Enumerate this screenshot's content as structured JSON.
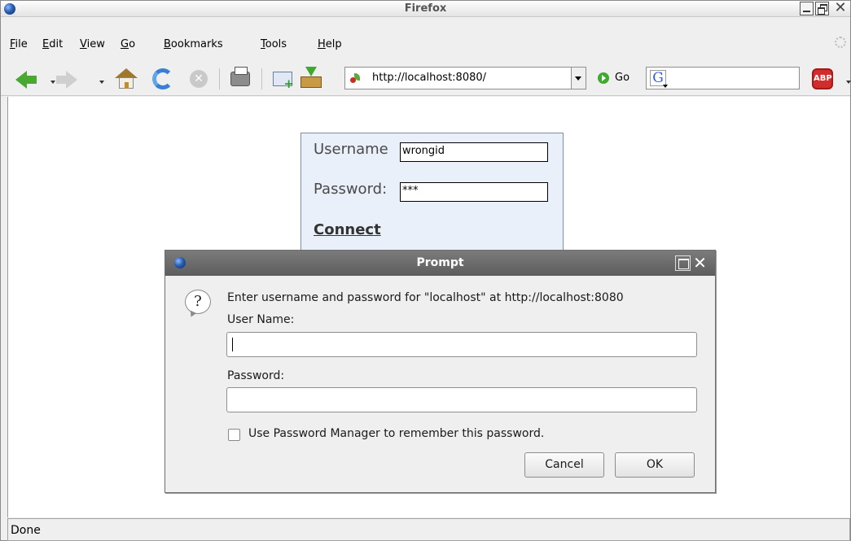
{
  "window": {
    "title": "Firefox"
  },
  "menubar": {
    "items": [
      {
        "label": "File"
      },
      {
        "label": "Edit"
      },
      {
        "label": "View"
      },
      {
        "label": "Go"
      },
      {
        "label": "Bookmarks"
      },
      {
        "label": "Tools"
      },
      {
        "label": "Help"
      }
    ]
  },
  "toolbar": {
    "url": "http://localhost:8080/",
    "go_label": "Go",
    "adblock_label": "ABP",
    "search_engine_glyph": "G",
    "icons": [
      "back-icon",
      "forward-icon",
      "home-icon",
      "reload-icon",
      "stop-icon",
      "print-icon",
      "new-tab-icon",
      "download-icon",
      "adblock-icon"
    ]
  },
  "login": {
    "username_label": "Username",
    "username_value": "wrongid",
    "password_label": "Password:",
    "password_value": "***",
    "connect_label": "Connect"
  },
  "prompt": {
    "title": "Prompt",
    "message": "Enter username and password for \"localhost\" at http://localhost:8080",
    "username_label": "User Name:",
    "username_value": "",
    "password_label": "Password:",
    "password_value": "",
    "remember_label": "Use Password Manager to remember this password.",
    "remember_checked": false,
    "cancel_label": "Cancel",
    "ok_label": "OK"
  },
  "status": {
    "text": "Done"
  },
  "colors": {
    "login_bg": "#e9f0f9",
    "dialog_titlebar": "#666666",
    "go_green": "#3faa2e",
    "adblock_red": "#d32c2c"
  }
}
